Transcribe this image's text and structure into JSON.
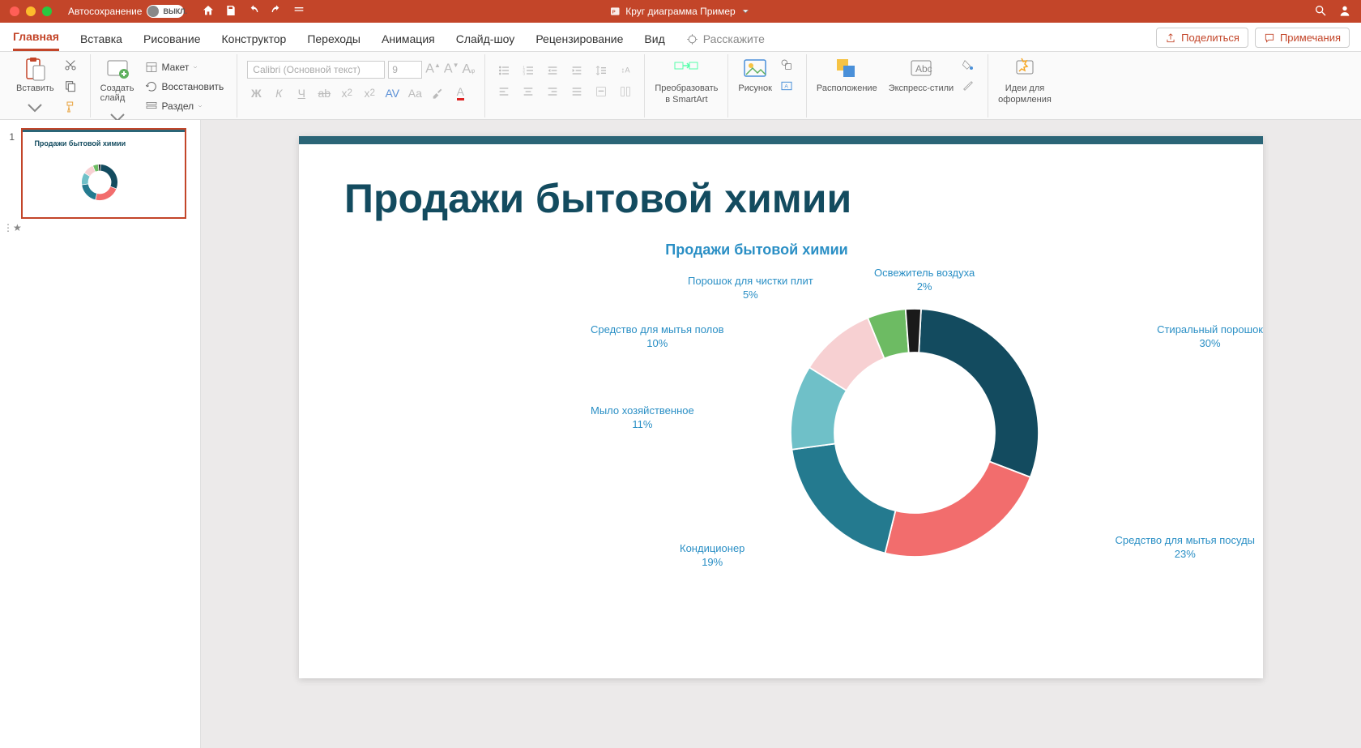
{
  "titlebar": {
    "autosave_label": "Автосохранение",
    "autosave_state": "ВЫКЛ.",
    "doc_title": "Круг диаграмма Пример"
  },
  "tabs": {
    "home": "Главная",
    "insert": "Вставка",
    "draw": "Рисование",
    "design": "Конструктор",
    "transitions": "Переходы",
    "animations": "Анимация",
    "slideshow": "Слайд-шоу",
    "review": "Рецензирование",
    "view": "Вид",
    "tellme": "Расскажите",
    "share": "Поделиться",
    "comments": "Примечания"
  },
  "ribbon": {
    "paste": "Вставить",
    "newslide": "Создать\nслайд",
    "layout": "Макет",
    "reset": "Восстановить",
    "section": "Раздел",
    "font_name": "Calibri (Основной текст)",
    "font_size": "9",
    "smartart_l1": "Преобразовать",
    "smartart_l2": "в SmartArt",
    "picture": "Рисунок",
    "arrange": "Расположение",
    "quickstyles": "Экспресс-стили",
    "ideas_l1": "Идеи для",
    "ideas_l2": "оформления"
  },
  "thumbs": {
    "n1": "1",
    "t1_title": "Продажи бытовой химии"
  },
  "slide": {
    "title": "Продажи бытовой химии"
  },
  "chart_data": {
    "type": "pie",
    "title": "Продажи бытовой химии",
    "series": [
      {
        "name": "Стиральный порошок",
        "value": 30,
        "color": "#134b5f"
      },
      {
        "name": "Средство для мытья посуды",
        "value": 23,
        "color": "#f26d6d"
      },
      {
        "name": "Кондиционер",
        "value": 19,
        "color": "#247a8f"
      },
      {
        "name": "Мыло хозяйственное",
        "value": 11,
        "color": "#6fc0c8"
      },
      {
        "name": "Средство для мытья полов",
        "value": 10,
        "color": "#f7d0d2"
      },
      {
        "name": "Порошок для чистки плит",
        "value": 5,
        "color": "#6dbb63"
      },
      {
        "name": "Освежитель воздуха",
        "value": 2,
        "color": "#1a1a1a"
      }
    ]
  },
  "labels": {
    "l0": {
      "name": "Стиральный порошок",
      "pct": "30%"
    },
    "l1": {
      "name": "Средство для мытья посуды",
      "pct": "23%"
    },
    "l2": {
      "name": "Кондиционер",
      "pct": "19%"
    },
    "l3": {
      "name": "Мыло хозяйственное",
      "pct": "11%"
    },
    "l4": {
      "name": "Средство для мытья полов",
      "pct": "10%"
    },
    "l5": {
      "name": "Порошок для чистки плит",
      "pct": "5%"
    },
    "l6": {
      "name": "Освежитель воздуха",
      "pct": "2%"
    }
  }
}
